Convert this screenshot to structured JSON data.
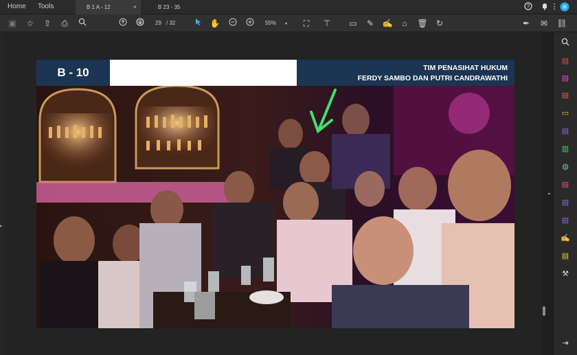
{
  "app": {
    "nav": [
      "Home",
      "Tools"
    ],
    "tabs": [
      {
        "label": "B 1 A - 12",
        "active": true
      },
      {
        "label": "B 23 - 35",
        "active": false
      }
    ]
  },
  "toolbar": {
    "current_page": "29",
    "total_pages": "/ 32",
    "zoom": "55%"
  },
  "document": {
    "slide_code": "B - 10",
    "header_line1": "TIM PENASIHAT HUKUM",
    "header_line2": "FERDY SAMBO DAN PUTRI CANDRAWATHI"
  },
  "colors": {
    "header_navy": "#1b3552",
    "arrow_green": "#3ee070",
    "bar_pink": "#e85bc2"
  },
  "icons": {
    "top_right": [
      "help-icon",
      "bell-icon",
      "menu-icon",
      "account-avatar"
    ],
    "toolbar": [
      "save-icon",
      "star-icon",
      "upload-icon",
      "print-icon",
      "zoom-out-search-icon",
      "page-up-icon",
      "page-down-icon",
      "cursor-icon",
      "hand-icon",
      "zoom-minus-icon",
      "zoom-plus-icon",
      "crop-icon",
      "stamp-icon",
      "comment-icon",
      "pen-icon",
      "sign-icon",
      "tag-icon",
      "trash-icon",
      "rotate-icon",
      "edit-sign-icon",
      "mail-icon",
      "link-icon"
    ],
    "right_rail": [
      "search-icon",
      "export-pdf-icon",
      "edit-pdf-icon",
      "create-pdf-icon",
      "comment-icon",
      "combine-icon",
      "organize-icon",
      "compress-icon",
      "redact-icon",
      "protect-icon",
      "sign-icon",
      "fill-sign-icon",
      "stamp-icon",
      "tools-icon",
      "collapse-icon"
    ]
  }
}
